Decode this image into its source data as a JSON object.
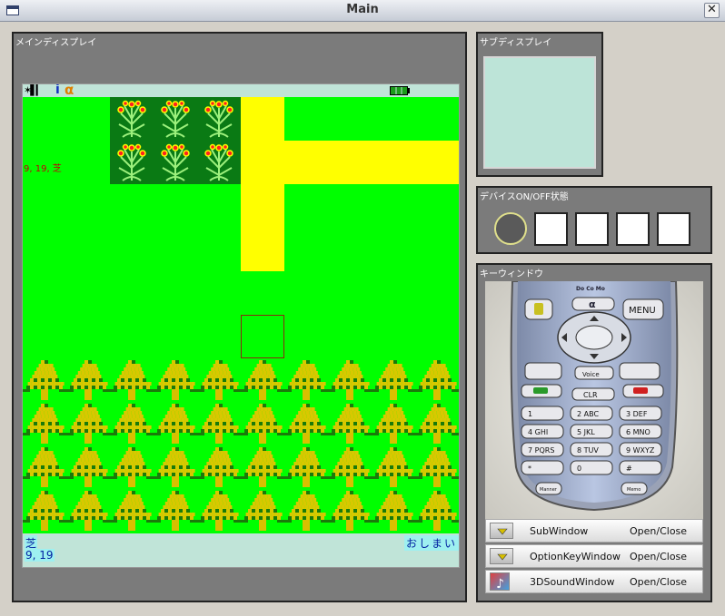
{
  "window": {
    "title": "Main",
    "close_glyph": "✕"
  },
  "main_display": {
    "label": "メインディスプレイ",
    "status": {
      "signal_glyph": "✶▌▎",
      "imode_glyph": "i",
      "alpha_glyph": "α"
    },
    "overlay_text": "9, 19, 芝",
    "bottom": {
      "left_top": "芝",
      "left_bottom": "9, 19",
      "right": "おしまい"
    }
  },
  "sub_display": {
    "label": "サブディスプレイ"
  },
  "device_status": {
    "label": "デバイスON/OFF状態"
  },
  "key_window": {
    "label": "キーウィンドウ",
    "phone": {
      "brand": "Do Co Mo",
      "menu_key": "MENU",
      "voice_key": "Voice",
      "clr_key": "CLR",
      "memo_key": "Memo",
      "manner_key": "Manner",
      "keys": [
        "1",
        "2 ABC",
        "3 DEF",
        "4 GHI",
        "5 JKL",
        "6 MNO",
        "7 PQRS",
        "8 TUV",
        "9 WXYZ",
        "*",
        "0",
        "#"
      ]
    },
    "rows": [
      {
        "label": "SubWindow",
        "action": "Open/Close",
        "icon": "dropdown-arrow-icon"
      },
      {
        "label": "OptionKeyWindow",
        "action": "Open/Close",
        "icon": "dropdown-arrow-icon"
      },
      {
        "label": "3DSoundWindow",
        "action": "Open/Close",
        "icon": "music-note-icon"
      }
    ]
  }
}
